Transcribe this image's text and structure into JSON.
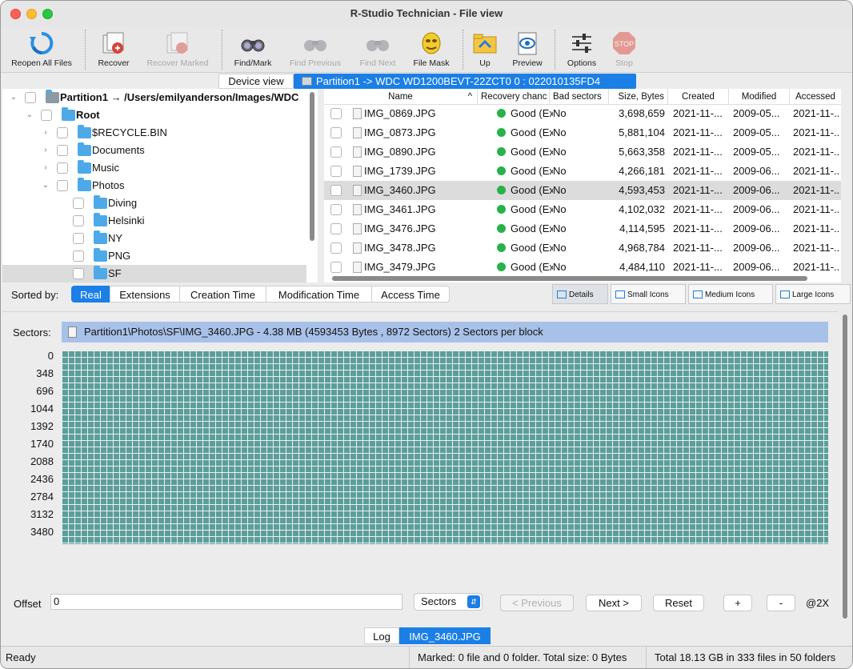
{
  "window": {
    "title": "R-Studio Technician - File view"
  },
  "toolbar": [
    {
      "label": "Reopen All Files",
      "icon": "reopen-icon",
      "enabled": true
    },
    {
      "label": "Recover",
      "icon": "recover-icon",
      "enabled": true
    },
    {
      "label": "Recover Marked",
      "icon": "recover-marked-icon",
      "enabled": false
    },
    {
      "label": "Find/Mark",
      "icon": "binoculars-icon",
      "enabled": true
    },
    {
      "label": "Find Previous",
      "icon": "binoculars-prev-icon",
      "enabled": false
    },
    {
      "label": "Find Next",
      "icon": "binoculars-next-icon",
      "enabled": false
    },
    {
      "label": "File Mask",
      "icon": "mask-icon",
      "enabled": true
    },
    {
      "label": "Up",
      "icon": "folder-up-icon",
      "enabled": true
    },
    {
      "label": "Preview",
      "icon": "preview-icon",
      "enabled": true
    },
    {
      "label": "Options",
      "icon": "sliders-icon",
      "enabled": true
    },
    {
      "label": "Stop",
      "icon": "stop-icon",
      "enabled": false
    }
  ],
  "view_tabs": {
    "device_view": "Device view",
    "partition": "Partition1 -> WDC WD1200BEVT-22ZCT0 0 : 022010135FD4"
  },
  "tree": [
    {
      "label": "Partition1 → /Users/emilyanderson/Images/WDC",
      "bold": true,
      "expand": "open"
    },
    {
      "label": "Root",
      "bold": true,
      "expand": "open"
    },
    {
      "label": "$RECYCLE.BIN",
      "expand": "closed"
    },
    {
      "label": "Documents",
      "expand": "closed"
    },
    {
      "label": "Music",
      "expand": "closed"
    },
    {
      "label": "Photos",
      "expand": "open"
    },
    {
      "label": "Diving"
    },
    {
      "label": "Helsinki"
    },
    {
      "label": "NY"
    },
    {
      "label": "PNG"
    },
    {
      "label": "SF",
      "selected": true
    }
  ],
  "filelist": {
    "columns": [
      "Name",
      "Recovery chanc",
      "Bad sectors",
      "Size, Bytes",
      "Created",
      "Modified",
      "Accessed"
    ],
    "rows": [
      {
        "name": "IMG_0869.JPG",
        "recovery": "Good (Exi",
        "bad": "No",
        "size": "3,698,659",
        "created": "2021-11-...",
        "modified": "2009-05...",
        "accessed": "2021-11-..."
      },
      {
        "name": "IMG_0873.JPG",
        "recovery": "Good (Exi",
        "bad": "No",
        "size": "5,881,104",
        "created": "2021-11-...",
        "modified": "2009-05...",
        "accessed": "2021-11-..."
      },
      {
        "name": "IMG_0890.JPG",
        "recovery": "Good (Exi",
        "bad": "No",
        "size": "5,663,358",
        "created": "2021-11-...",
        "modified": "2009-05...",
        "accessed": "2021-11-..."
      },
      {
        "name": "IMG_1739.JPG",
        "recovery": "Good (Exi",
        "bad": "No",
        "size": "4,266,181",
        "created": "2021-11-...",
        "modified": "2009-06...",
        "accessed": "2021-11-..."
      },
      {
        "name": "IMG_3460.JPG",
        "recovery": "Good (Exi",
        "bad": "No",
        "size": "4,593,453",
        "created": "2021-11-...",
        "modified": "2009-06...",
        "accessed": "2021-11-...",
        "selected": true
      },
      {
        "name": "IMG_3461.JPG",
        "recovery": "Good (Exi",
        "bad": "No",
        "size": "4,102,032",
        "created": "2021-11-...",
        "modified": "2009-06...",
        "accessed": "2021-11-..."
      },
      {
        "name": "IMG_3476.JPG",
        "recovery": "Good (Exi",
        "bad": "No",
        "size": "4,114,595",
        "created": "2021-11-...",
        "modified": "2009-06...",
        "accessed": "2021-11-..."
      },
      {
        "name": "IMG_3478.JPG",
        "recovery": "Good (Exi",
        "bad": "No",
        "size": "4,968,784",
        "created": "2021-11-...",
        "modified": "2009-06...",
        "accessed": "2021-11-..."
      },
      {
        "name": "IMG_3479.JPG",
        "recovery": "Good (Exi",
        "bad": "No",
        "size": "4,484,110",
        "created": "2021-11-...",
        "modified": "2009-06...",
        "accessed": "2021-11-..."
      }
    ]
  },
  "sortbar": {
    "label": "Sorted by:",
    "options": [
      "Real",
      "Extensions",
      "Creation Time",
      "Modification Time",
      "Access Time"
    ],
    "active": "Real",
    "views": [
      {
        "label": "Details",
        "active": true
      },
      {
        "label": "Small Icons"
      },
      {
        "label": "Medium Icons"
      },
      {
        "label": "Large Icons"
      }
    ]
  },
  "sectors": {
    "label": "Sectors:",
    "info": "Partition1\\Photos\\SF\\IMG_3460.JPG - 4.38 MB (4593453 Bytes , 8972 Sectors) 2 Sectors per block",
    "row_ticks": [
      "0",
      "348",
      "696",
      "1044",
      "1392",
      "1740",
      "2088",
      "2436",
      "2784",
      "3132",
      "3480"
    ],
    "block_color": "#5c9e9b",
    "offset_label": "Offset",
    "offset_value": "0",
    "unit": "Sectors",
    "prev_label": "< Previous",
    "next_label": "Next >",
    "reset_label": "Reset",
    "plus_label": "+",
    "minus_label": "-",
    "zoom": "@2X"
  },
  "bottom_tabs": [
    "Log",
    "IMG_3460.JPG"
  ],
  "status": {
    "ready": "Ready",
    "marked": "Marked: 0 file and 0 folder. Total size: 0 Bytes",
    "total": "Total 18.13 GB in 333 files in 50 folders"
  },
  "colors": {
    "accent": "#1b7fe5",
    "good": "#27b24a",
    "selection": "#dcdcdc",
    "sector_header": "#a8c1e8"
  }
}
